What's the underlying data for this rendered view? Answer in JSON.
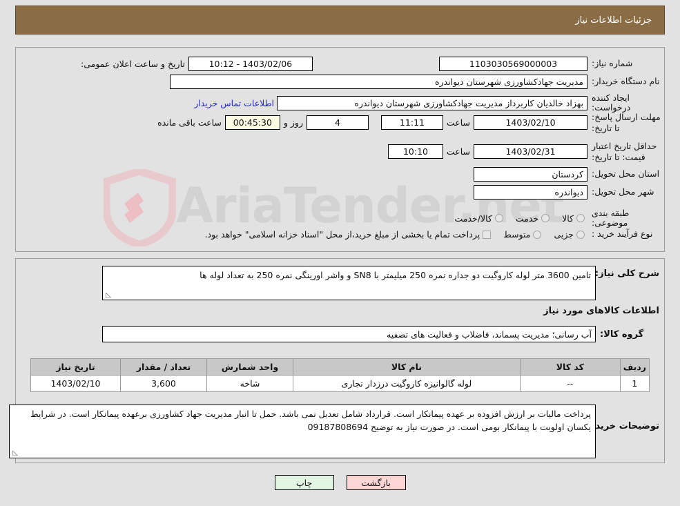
{
  "header": {
    "title": "جزئیات اطلاعات نیاز"
  },
  "info": {
    "need_number_label": "شماره نیاز:",
    "need_number_value": "1103030569000003",
    "public_announce_label": "تاریخ و ساعت اعلان عمومی:",
    "public_announce_value": "1403/02/06 - 10:12",
    "buyer_org_label": "نام دستگاه خریدار:",
    "buyer_org_value": "مدیریت جهادکشاورزی شهرستان دیواندره",
    "creator_label": "ایجاد کننده درخواست:",
    "creator_value": "بهزاد خالدیان کاربرداز مدیریت جهادکشاورزی شهرستان دیواندره",
    "contact_link": "اطلاعات تماس خریدار",
    "deadline_label": "مهلت ارسال پاسخ: تا تاریخ:",
    "deadline_date": "1403/02/10",
    "hour_label": "ساعت",
    "deadline_time": "11:11",
    "days_remaining": "4",
    "days_word": "روز و",
    "countdown": "00:45:30",
    "remaining_suffix": "ساعت باقی مانده",
    "price_validity_label": "حداقل تاریخ اعتبار قیمت: تا تاریخ:",
    "price_validity_date": "1403/02/31",
    "price_validity_hour_label": "ساعت",
    "price_validity_time": "10:10",
    "province_label": "استان محل تحویل:",
    "province_value": "کردستان",
    "city_label": "شهر محل تحویل:",
    "city_value": "دیواندره",
    "category_label": "طبقه بندی موضوعی:",
    "category_options": [
      "کالا",
      "خدمت",
      "کالا/خدمت"
    ],
    "process_label": "نوع فرآیند خرید :",
    "process_options": [
      "جزیی",
      "متوسط"
    ],
    "treasury_note": "پرداخت تمام یا بخشی از مبلغ خرید،از محل \"اسناد خزانه اسلامی\" خواهد بود."
  },
  "description": {
    "label": "شرح کلی نیاز:",
    "value": "تامین 3600 متر لوله کاروگیت دو جداره نمره 250 میلیمتر با SN8 و واشر اورینگی نمره 250 به تعداد لوله ها"
  },
  "goods_section": {
    "heading": "اطلاعات کالاهای مورد نیاز",
    "group_label": "گروه کالا:",
    "group_value": "آب رسانی؛ مدیریت پسماند، فاضلاب و فعالیت های تصفیه"
  },
  "table": {
    "columns": [
      "ردیف",
      "کد کالا",
      "نام کالا",
      "واحد شمارش",
      "تعداد / مقدار",
      "تاریخ نیاز"
    ],
    "rows": [
      {
        "radif": "1",
        "code": "--",
        "name": "لوله گالوانیزه کاروگیت درزدار تجاری",
        "unit": "شاخه",
        "quantity": "3,600",
        "need_date": "1403/02/10"
      }
    ]
  },
  "buyer_notes": {
    "label": "توضیحات خریدار:",
    "value": "پرداخت مالیات بر ارزش افزوده بر عهده پیمانکار است. قرارداد شامل تعدیل نمی باشد. حمل تا انبار مدیریت جهاد کشاورزی برعهده پیمانکار است. در شرایط یکسان اولویت با پیمانکار بومی است. در صورت نیاز به توضیح 09187808694"
  },
  "footer": {
    "print_label": "چاپ",
    "back_label": "بازگشت"
  },
  "watermark": {
    "text": "AriaTender.net"
  },
  "colors": {
    "header_bg": "#8a6d45",
    "page_bg": "#e2e2e2",
    "link": "#2222cc",
    "countdown_bg": "#fbfbe4",
    "table_header_bg": "#c8c8c8",
    "btn_back_bg": "#fcd5d5",
    "btn_print_bg": "#e2f5e2"
  }
}
